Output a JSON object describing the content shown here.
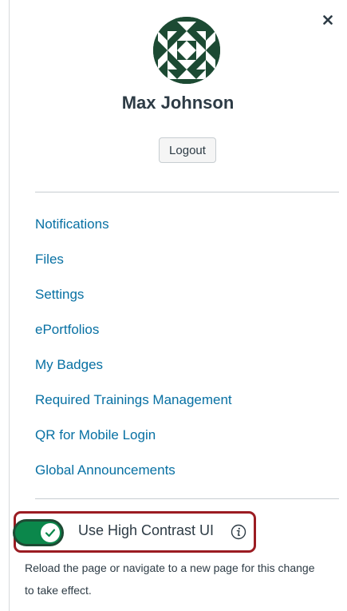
{
  "tray": {
    "close_icon": "close-icon",
    "avatar_icon": "quilt-avatar"
  },
  "user": {
    "name": "Max Johnson",
    "logout_label": "Logout"
  },
  "nav": {
    "items": [
      {
        "label": "Notifications"
      },
      {
        "label": "Files"
      },
      {
        "label": "Settings"
      },
      {
        "label": "ePortfolios"
      },
      {
        "label": "My Badges"
      },
      {
        "label": "Required Trainings Management"
      },
      {
        "label": "QR for Mobile Login"
      },
      {
        "label": "Global Announcements"
      }
    ]
  },
  "high_contrast": {
    "label": "Use High Contrast UI",
    "enabled": true,
    "info_icon": "info-icon",
    "help_text": "Reload the page or navigate to a new page for this change to take effect."
  },
  "colors": {
    "link": "#0770a3",
    "toggle_on": "#0b874b",
    "highlight_border": "#9b1c22",
    "text": "#2d3b45"
  }
}
